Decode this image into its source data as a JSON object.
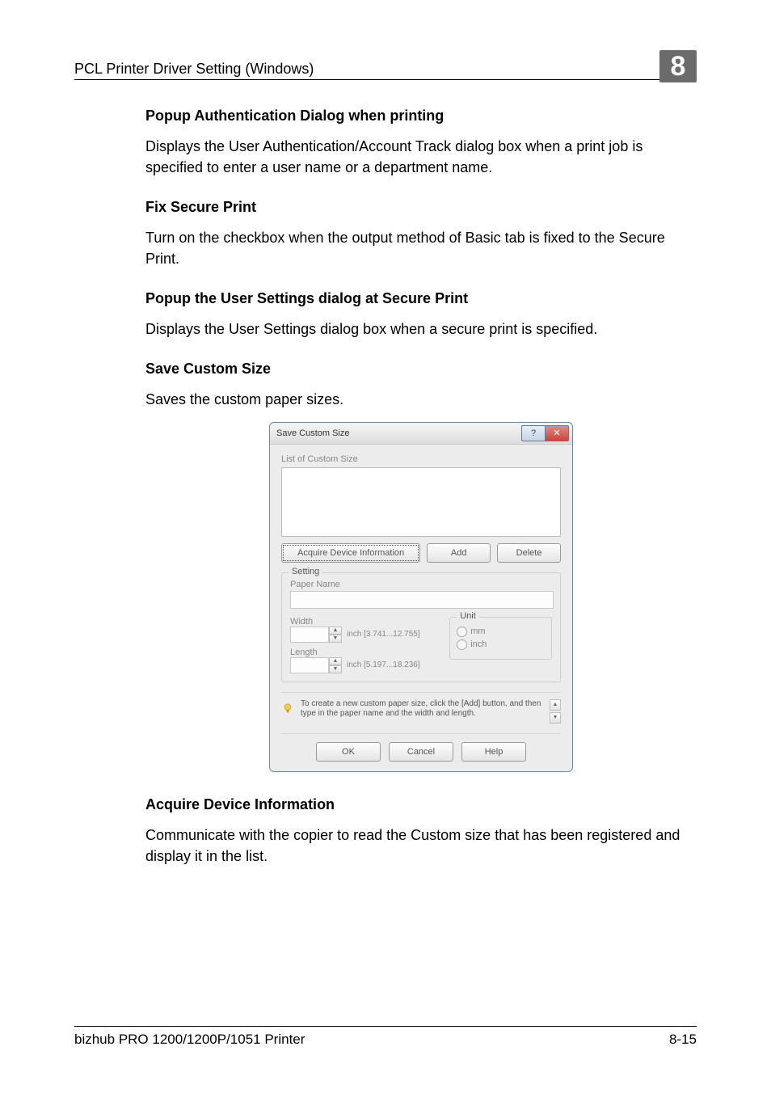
{
  "header": {
    "section_title": "PCL Printer Driver Setting (Windows)",
    "chapter_number": "8"
  },
  "sections": [
    {
      "heading": "Popup Authentication Dialog when printing",
      "body": "Displays the User Authentication/Account Track dialog box when a print job is specified to enter a user name or a department name."
    },
    {
      "heading": "Fix Secure Print",
      "body": "Turn on the checkbox when the output method of Basic tab is fixed to the Secure Print."
    },
    {
      "heading": "Popup the User Settings dialog at Secure Print",
      "body": "Displays the User Settings dialog box when a secure print is specified."
    },
    {
      "heading": "Save Custom Size",
      "body": "Saves the custom paper sizes."
    }
  ],
  "dialog": {
    "title": "Save Custom Size",
    "list_label": "List of Custom Size",
    "buttons": {
      "acquire": "Acquire Device Information",
      "add": "Add",
      "delete": "Delete"
    },
    "setting": {
      "legend": "Setting",
      "paper_name_label": "Paper Name",
      "width_label": "Width",
      "width_range": "inch [3.741...12.755]",
      "length_label": "Length",
      "length_range": "inch [5.197...18.236]",
      "unit_legend": "Unit",
      "unit_mm": "mm",
      "unit_inch": "inch"
    },
    "note": "To create a new custom paper size, click the [Add] button, and then type in the paper name and the width and length.",
    "bottom": {
      "ok": "OK",
      "cancel": "Cancel",
      "help": "Help"
    }
  },
  "after_dialog": {
    "heading": "Acquire Device Information",
    "body": "Communicate with the copier to read the Custom size that has been registered and display it in the list."
  },
  "footer": {
    "product": "bizhub PRO 1200/1200P/1051 Printer",
    "page": "8-15"
  }
}
